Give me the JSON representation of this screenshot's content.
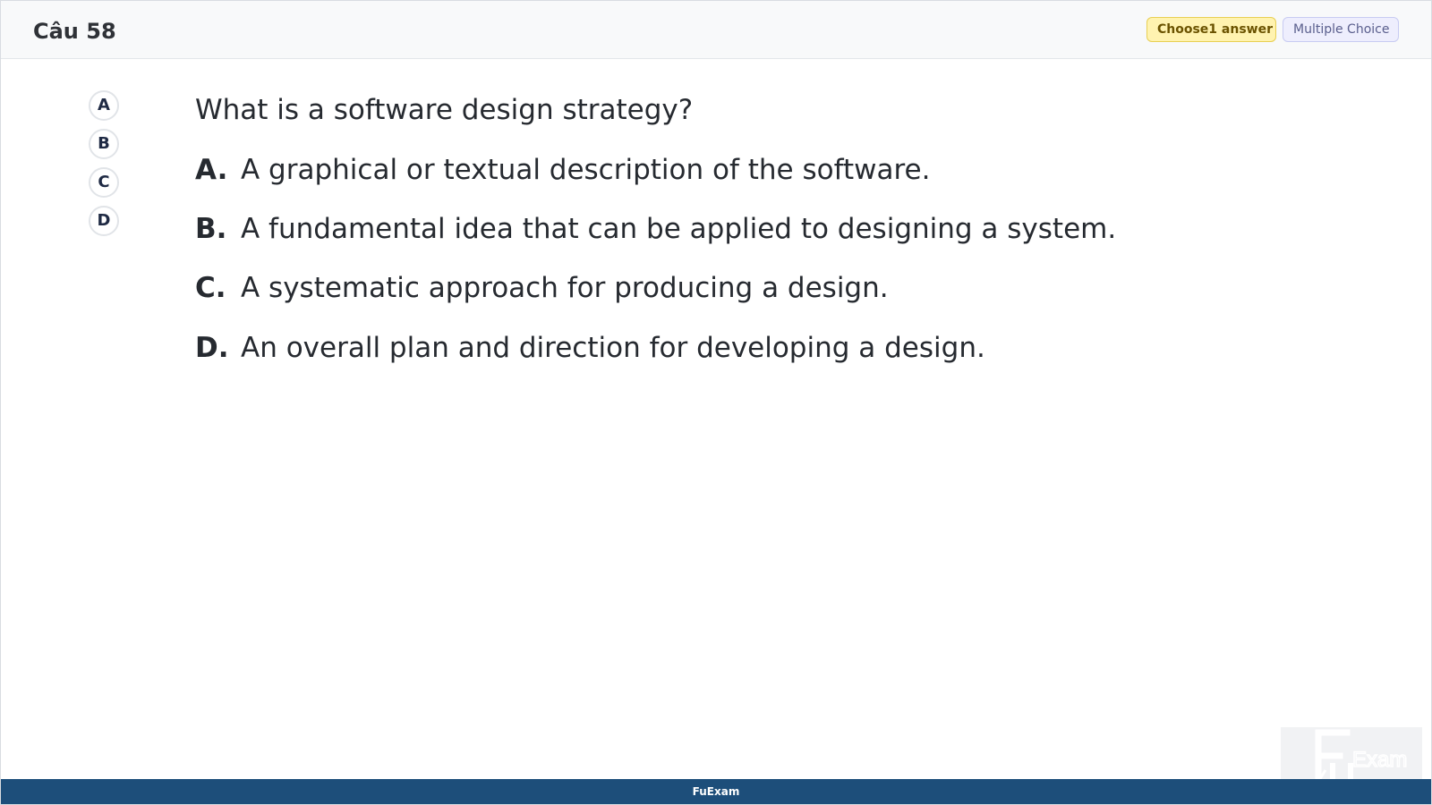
{
  "header": {
    "question_label": "Câu 58",
    "choose_badge": "Choose1 answer",
    "type_badge": "Multiple Choice"
  },
  "answer_buttons": [
    "A",
    "B",
    "C",
    "D"
  ],
  "question": {
    "text": "What is a software design strategy?"
  },
  "options": [
    {
      "letter": "A.",
      "text": "A graphical or textual description of the software."
    },
    {
      "letter": "B.",
      "text": "A fundamental idea that can be applied to designing a system."
    },
    {
      "letter": "C.",
      "text": "A systematic approach for producing a design."
    },
    {
      "letter": "D.",
      "text": "An overall plan and direction for developing a design."
    }
  ],
  "footer": {
    "brand": "FuExam"
  },
  "watermark": {
    "logo_text": "Exam",
    "logo_icon": "fu-exam-logo"
  },
  "colors": {
    "footer_bg": "#1d4e7a",
    "choose_badge_bg": "#fff3b0",
    "type_badge_bg": "#eeeefd"
  }
}
